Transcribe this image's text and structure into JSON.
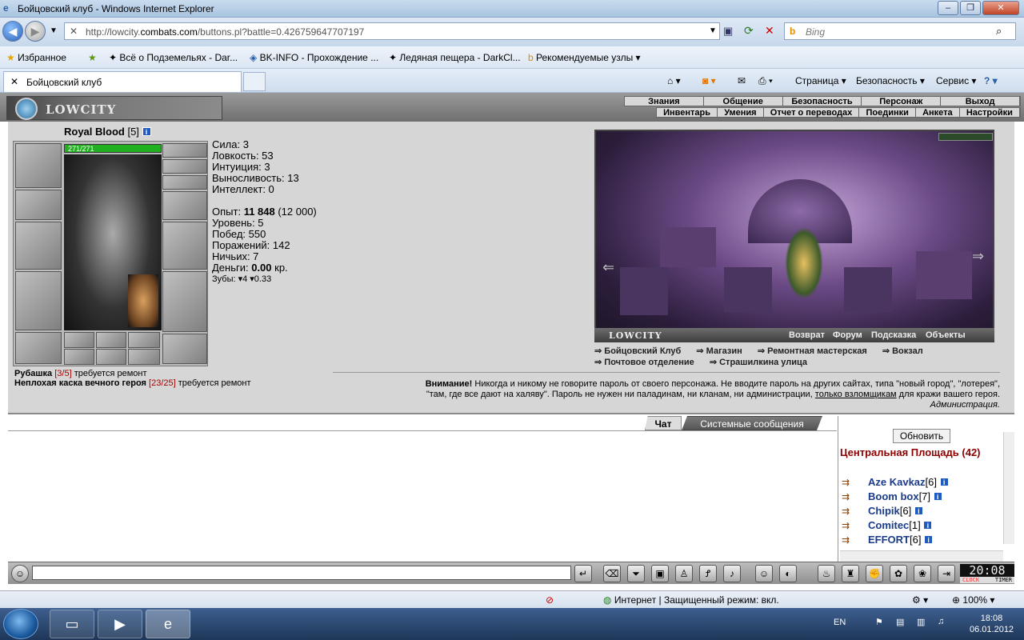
{
  "window": {
    "title": "Бойцовский клуб - Windows Internet Explorer",
    "min_label": "–",
    "max_label": "❐",
    "close_label": "✕"
  },
  "address": {
    "url_prefix": "http://lowcity.",
    "url_domain": "combats.com",
    "url_suffix": "/buttons.pl?battle=0.426759647707197",
    "search_placeholder": "Bing"
  },
  "favorites": {
    "label": "Избранное",
    "items": [
      "Всё о Подземельях - Dar...",
      "BK-INFO - Прохождение ...",
      "Ледяная пещера - DarkCl...",
      "Рекомендуемые узлы"
    ]
  },
  "tab": {
    "title": "Бойцовский клуб"
  },
  "commandbar": {
    "page": "Страница",
    "security": "Безопасность",
    "service": "Сервис"
  },
  "game": {
    "logo": "LOWCITY",
    "menu_top": [
      "Знания",
      "Общение",
      "Безопасность",
      "Персонаж",
      "Выход"
    ],
    "menu_bottom": [
      "Инвентарь",
      "Умения",
      "Отчет о переводах",
      "Поединки",
      "Анкета",
      "Настройки"
    ]
  },
  "character": {
    "name": "Royal Blood",
    "level": "[5]",
    "hp": "271/271",
    "stats": {
      "strength": "Сила: 3",
      "agility": "Ловкость: 53",
      "intuition": "Интуиция: 3",
      "endurance": "Выносливость: 13",
      "intellect": "Интеллект: 0"
    },
    "exp_label": "Опыт: ",
    "exp_value": "11 848",
    "exp_next": " (12 000)",
    "level_line": "Уровень: 5",
    "wins": "Побед: 550",
    "losses": "Поражений: 142",
    "draws": "Ничьих: 7",
    "money_label": "Деньги: ",
    "money_value": "0.00",
    "money_unit": " кр.",
    "teeth": "Зубы: ▾4 ▾0.33"
  },
  "repair": [
    {
      "item": "Рубашка",
      "dur": "[3/5]",
      "note": " требуется ремонт"
    },
    {
      "item": "Неплохая каска вечного героя",
      "dur": "[23/25]",
      "note": " требуется ремонт"
    }
  ],
  "location": {
    "name": "LOWCITY",
    "links": [
      "Возврат",
      "Форум",
      "Подсказка",
      "Объекты"
    ],
    "places": [
      "Бойцовский Клуб",
      "Магазин",
      "Ремонтная мастерская",
      "Вокзал",
      "Почтовое отделение",
      "Страшилкина улица"
    ]
  },
  "warning": {
    "bold": "Внимание!",
    "text1": " Никогда и никому не говорите пароль от своего персонажа. Не вводите пароль на других сайтах, типа \"новый город\", \"лотерея\",",
    "text2": "\"там, где все дают на халяву\". Пароль не нужен ни паладинам, ни кланам, ни администрации, ",
    "underlined": "только взломщикам",
    "text3": " для кражи вашего героя.",
    "signature": "Администрация."
  },
  "chat": {
    "tab_chat": "Чат",
    "tab_system": "Системные сообщения",
    "refresh": "Обновить",
    "room": "Центральная Площадь (42)",
    "users": [
      {
        "name": "Aze Kavkaz",
        "level": "[6]"
      },
      {
        "name": "Boom box",
        "level": "[7]"
      },
      {
        "name": "Chipik",
        "level": "[6]"
      },
      {
        "name": "Comitec",
        "level": "[1]"
      },
      {
        "name": "EFFORT",
        "level": "[6]"
      }
    ]
  },
  "clock": {
    "time": "20:08",
    "label_left": "CLOCK",
    "label_right": "TIMER"
  },
  "statusbar": {
    "zone": "Интернет | Защищенный режим: вкл.",
    "zoom": "100%"
  },
  "taskbar": {
    "lang": "EN",
    "time": "18:08",
    "date": "06.01.2012"
  }
}
